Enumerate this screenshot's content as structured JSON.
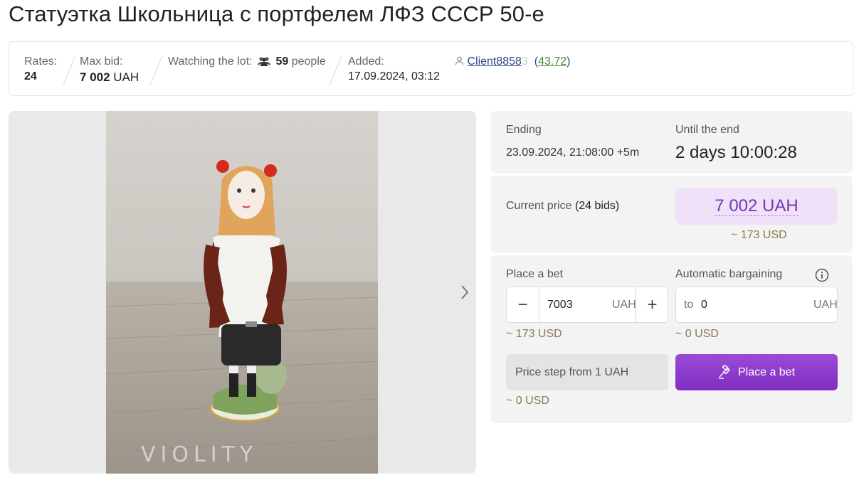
{
  "page": {
    "title": "Статуэтка Школьница с портфелем ЛФЗ СССР 50-е"
  },
  "info": {
    "rates_label": "Rates:",
    "rates_value": "24",
    "max_bid_label": "Max bid:",
    "max_bid_amount": "7 002",
    "max_bid_currency": "UAH",
    "watching_label": "Watching the lot:",
    "watching_count": "59",
    "watching_unit": "people",
    "added_label": "Added:",
    "added_value": "17.09.2024, 03:12",
    "seller_name": "Client8858",
    "seller_name_faded": "3",
    "seller_rating": "43.72"
  },
  "gallery": {
    "watermark": "VIOLITY"
  },
  "ending": {
    "label": "Ending",
    "value": "23.09.2024, 21:08:00 +5m",
    "until_label": "Until the end",
    "until_value": "2 days 10:00:28"
  },
  "price": {
    "label": "Current price",
    "bids": "(24 bids)",
    "value": "7 002 UAH",
    "usd": "~ 173 USD"
  },
  "bet": {
    "place_label": "Place a bet",
    "auto_label": "Automatic bargaining",
    "amount": "7003",
    "currency": "UAH",
    "usd": "~ 173 USD",
    "auto_prefix": "to",
    "auto_amount": "0",
    "auto_currency": "UAH",
    "auto_usd": "~ 0 USD",
    "step_text": "Price step from 1 UAH",
    "step_usd": "~ 0 USD",
    "button_label": "Place a bet"
  },
  "colors": {
    "accent": "#8a3ecb",
    "price_bg": "#efe1f8",
    "usd_text": "#8a7a50",
    "panel_bg": "#f3f3f3"
  },
  "icons": [
    "people-icon",
    "user-icon",
    "chevron-right-icon",
    "minus-icon",
    "plus-icon",
    "info-icon",
    "gavel-icon"
  ]
}
